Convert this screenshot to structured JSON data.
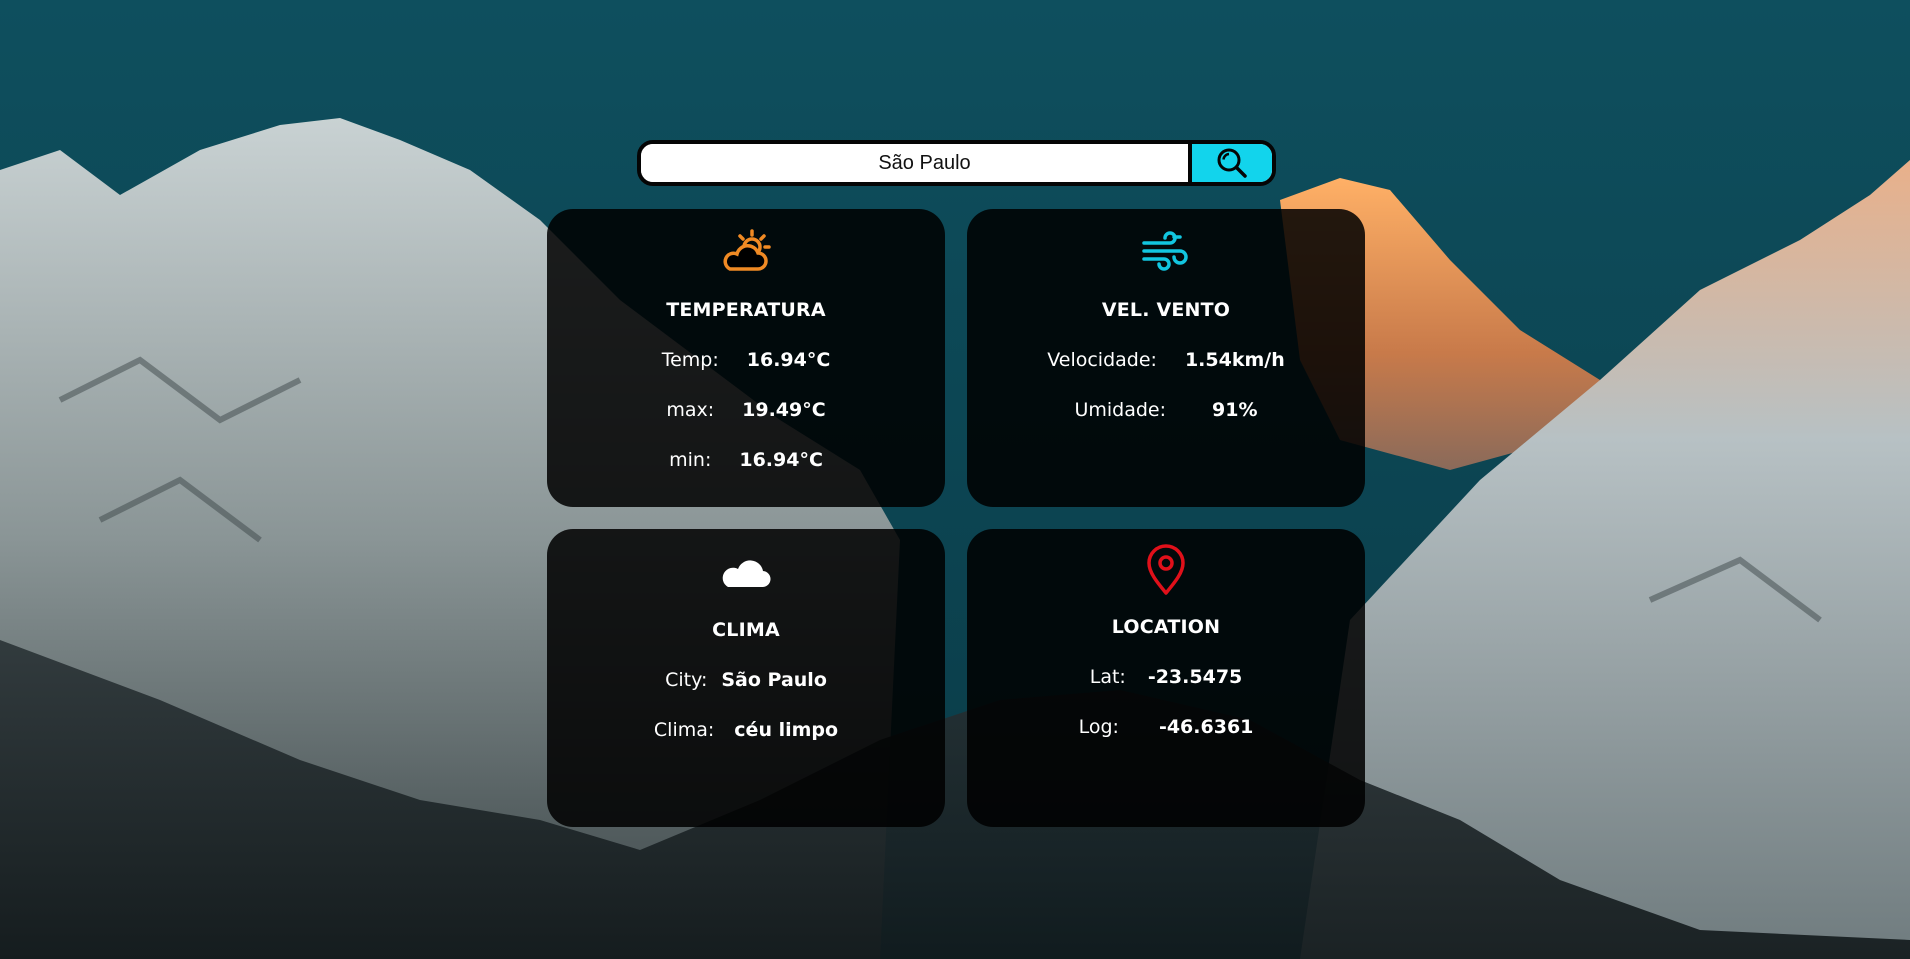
{
  "search": {
    "value": "São Paulo",
    "placeholder": ""
  },
  "icons": {
    "search": "search-icon",
    "temperature": "partly-sunny-icon",
    "wind": "wind-icon",
    "weather": "cloud-icon",
    "location": "map-pin-icon"
  },
  "colors": {
    "accent": "#12d4ec",
    "sun": "#f08a24",
    "wind": "#12c6e0",
    "pin": "#e0101a",
    "card_bg": "#000000"
  },
  "temperature": {
    "title": "TEMPERATURA",
    "temp_label": "Temp:",
    "temp_value": "16.94°C",
    "max_label": "max:",
    "max_value": "19.49°C",
    "min_label": "min:",
    "min_value": "16.94°C"
  },
  "wind": {
    "title": "VEL. VENTO",
    "speed_label": "Velocidade:",
    "speed_value": "1.54km/h",
    "humidity_label": "Umidade:",
    "humidity_value": "91%"
  },
  "weather": {
    "title": "CLIMA",
    "city_label": "City:",
    "city_value": "São Paulo",
    "clima_label": "Clima:",
    "clima_value": "céu limpo"
  },
  "location": {
    "title": "LOCATION",
    "lat_label": "Lat:",
    "lat_value": "-23.5475",
    "log_label": "Log:",
    "log_value": "-46.6361"
  }
}
